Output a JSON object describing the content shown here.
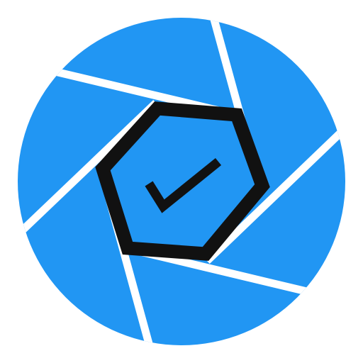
{
  "logo": {
    "icon": "camera-aperture-checkmark-icon",
    "colors": {
      "background": "#ffffff",
      "blade": "#2196f3",
      "gap": "#ffffff",
      "hexagon_outline": "#111111",
      "hexagon_fill": "#2196f3",
      "checkmark": "#111111"
    },
    "aperture_blades": 6
  }
}
